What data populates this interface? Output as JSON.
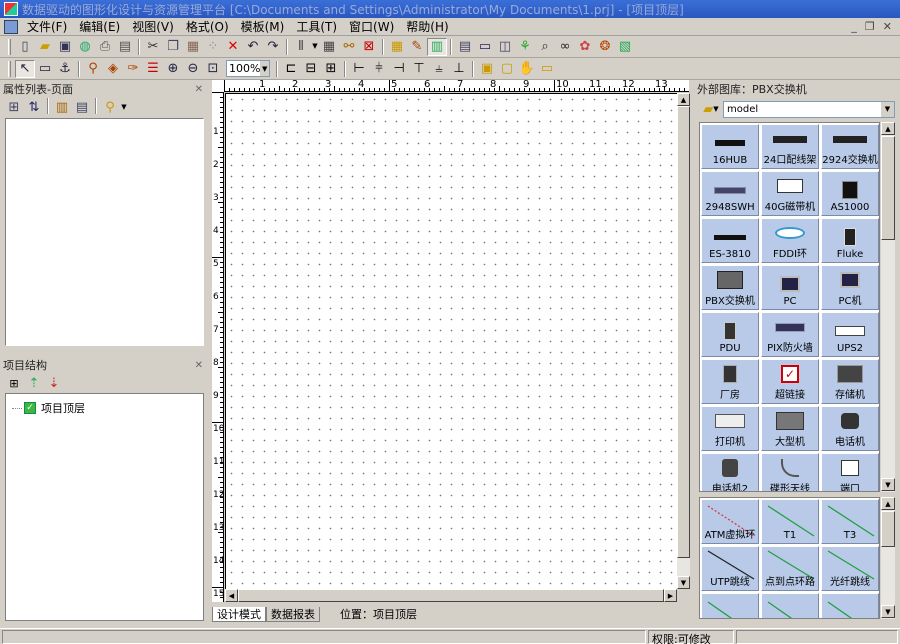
{
  "window": {
    "title": "数据驱动的图形化设计与资源管理平台 [C:\\Documents and Settings\\Administrator\\My Documents\\1.prj] - [项目顶层]"
  },
  "menu": [
    "文件(F)",
    "编辑(E)",
    "视图(V)",
    "格式(O)",
    "模板(M)",
    "工具(T)",
    "窗口(W)",
    "帮助(H)"
  ],
  "window_buttons": [
    "_",
    "❐",
    "✕"
  ],
  "zoom": {
    "value": "100%"
  },
  "left_panel": {
    "properties_title": "属性列表-页面",
    "structure_title": "项目结构",
    "tree_root": "项目顶层"
  },
  "right_panel": {
    "title": "外部图库：PBX交换机",
    "library_select": "model",
    "devices": [
      "16HUB",
      "24口配线架",
      "2924交换机",
      "2948SWH",
      "40G磁带机",
      "AS1000",
      "ES-3810",
      "FDDI环",
      "Fluke",
      "PBX交换机",
      "PC",
      "PC机",
      "PDU",
      "PIX防火墙",
      "UPS2",
      "厂房",
      "超链接",
      "存储机",
      "打印机",
      "大型机",
      "电话机",
      "电话机2",
      "碟形天线",
      "端口"
    ],
    "lines": [
      "ATM虚拟环",
      "T1",
      "T3",
      "UTP跳线",
      "点到点环路",
      "光纤跳线",
      "",
      "",
      ""
    ]
  },
  "ruler": {
    "h": [
      "1",
      "2",
      "3",
      "4",
      "5",
      "6",
      "7",
      "8",
      "9",
      "10",
      "11",
      "12",
      "13"
    ],
    "v": [
      "1",
      "2",
      "3",
      "4",
      "5",
      "6",
      "7",
      "8",
      "9",
      "10",
      "11",
      "12",
      "13",
      "14",
      "15"
    ]
  },
  "tabs": [
    "设计模式",
    "数据报表"
  ],
  "position": "位置：项目顶层",
  "status": {
    "permission": "权限:可修改"
  },
  "colors": {
    "title_bar": "#2a57c0",
    "panel_bg": "#d4d0c8",
    "tile_bg": "#b8cae8"
  }
}
